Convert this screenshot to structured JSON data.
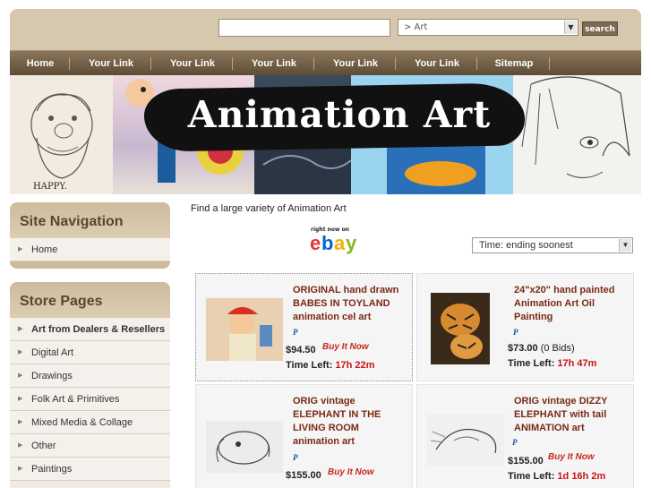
{
  "header": {
    "search_value": "",
    "category_value": "> Art",
    "search_button": "search"
  },
  "nav": {
    "items": [
      "Home",
      "Your Link",
      "Your Link",
      "Your Link",
      "Your Link",
      "Your Link",
      "Sitemap"
    ]
  },
  "banner": {
    "title": "Animation Art",
    "sketch_caption": "HAPPY."
  },
  "site_nav": {
    "heading": "Site Navigation",
    "items": [
      "Home"
    ]
  },
  "store_pages": {
    "heading": "Store Pages",
    "items": [
      "Art from Dealers & Resellers",
      "Digital Art",
      "Drawings",
      "Folk Art & Primitives",
      "Mixed Media & Collage",
      "Other",
      "Paintings"
    ]
  },
  "main": {
    "intro": "Find a large variety of Animation Art",
    "ebay_tagline": "right now on",
    "ebay_letters": [
      "e",
      "b",
      "a",
      "y"
    ],
    "sort_value": "Time: ending soonest"
  },
  "colors": {
    "accent_brown": "#5e4c36",
    "title_red": "#7a2a14",
    "time_red": "#c81414",
    "ebay": [
      "#e53238",
      "#0064d2",
      "#f5af02",
      "#86b817"
    ]
  },
  "listings": [
    {
      "title_lines": [
        "ORIGINAL hand drawn",
        "BABES IN TOYLAND",
        "animation cel art"
      ],
      "paypal": "P",
      "price": "$94.50",
      "bids": "",
      "buy_it_now": "Buy It Now",
      "time_label": "Time Left:",
      "time_left": "17h 22m"
    },
    {
      "title_lines": [
        "24\"x20\" hand painted",
        "Animation Art Oil",
        "Painting"
      ],
      "paypal": "P",
      "price": "$73.00",
      "bids": "(0 Bids)",
      "buy_it_now": "",
      "time_label": "Time Left:",
      "time_left": "17h 47m"
    },
    {
      "title_lines": [
        "ORIG vintage",
        "ELEPHANT IN THE",
        "LIVING ROOM",
        "animation art"
      ],
      "paypal": "P",
      "price": "$155.00",
      "bids": "",
      "buy_it_now": "Buy It Now",
      "time_label": "",
      "time_left": ""
    },
    {
      "title_lines": [
        "ORIG vintage DIZZY",
        "ELEPHANT with tail",
        "ANIMATION art"
      ],
      "paypal": "P",
      "price": "$155.00",
      "bids": "",
      "buy_it_now": "Buy It Now",
      "time_label": "Time Left:",
      "time_left": "1d 16h 2m"
    }
  ]
}
